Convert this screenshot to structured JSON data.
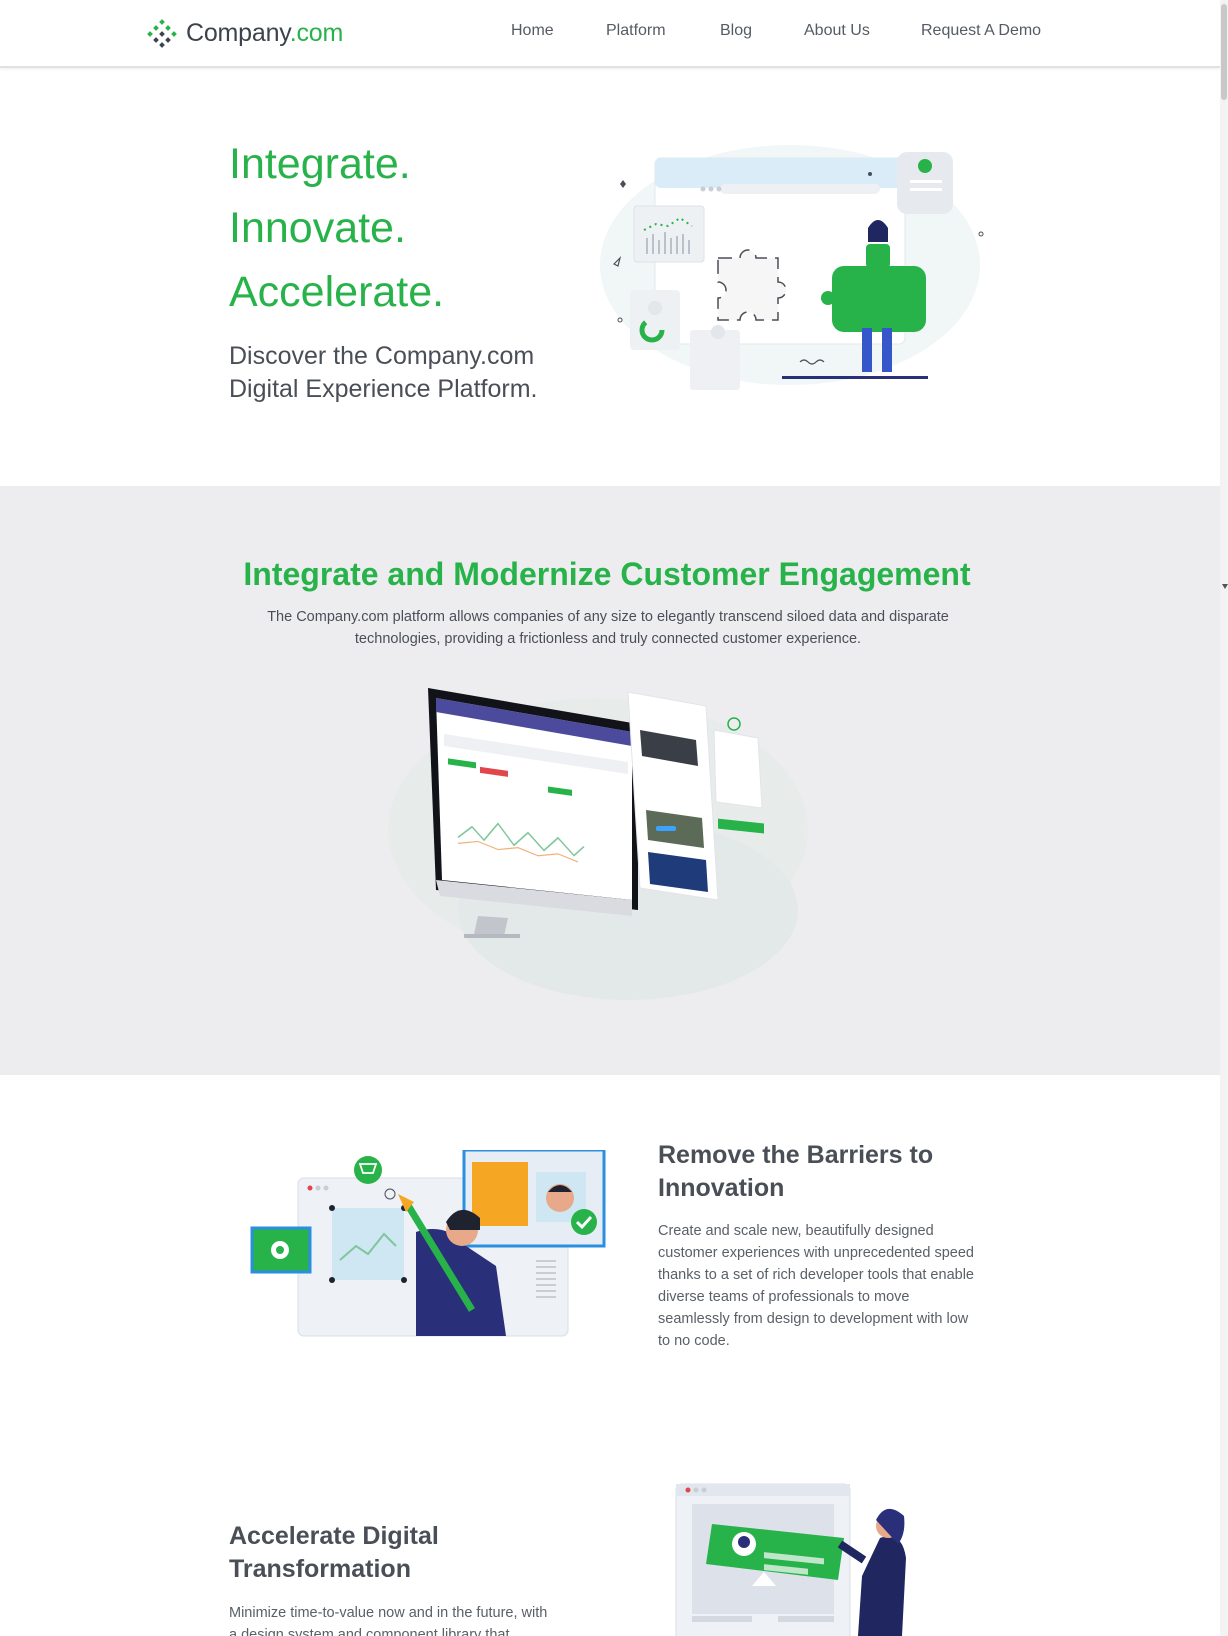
{
  "header": {
    "logo": {
      "brand": "Company",
      "suffix": ".com"
    },
    "nav": [
      {
        "label": "Home"
      },
      {
        "label": "Platform"
      },
      {
        "label": "Blog"
      },
      {
        "label": "About Us"
      },
      {
        "label": "Request A Demo"
      }
    ]
  },
  "hero": {
    "lines": [
      "Integrate.",
      "Innovate.",
      "Accelerate."
    ],
    "subtitle": "Discover the Company.com Digital Experience Platform."
  },
  "engagement": {
    "title": "Integrate and Modernize Customer Engagement",
    "description": "The Company.com platform allows companies of any size to elegantly transcend siloed data and disparate technologies, providing a frictionless and truly connected customer experience."
  },
  "features": [
    {
      "title": "Remove the Barriers to Innovation",
      "description": "Create and scale new, beautifully designed customer experiences with unprecedented speed thanks to a set of rich developer tools that enable diverse teams of professionals to move seamlessly from design to development with low to no code."
    },
    {
      "title": "Accelerate Digital Transformation",
      "description": "Minimize time-to-value now and in the future, with a design system and component library that"
    }
  ],
  "colors": {
    "accent": "#27b24a",
    "text": "#4a4f57",
    "section_bg": "#ededf0",
    "navy": "#2a2f7a"
  },
  "icons": [
    "logo-mark-icon",
    "scrollbar"
  ]
}
